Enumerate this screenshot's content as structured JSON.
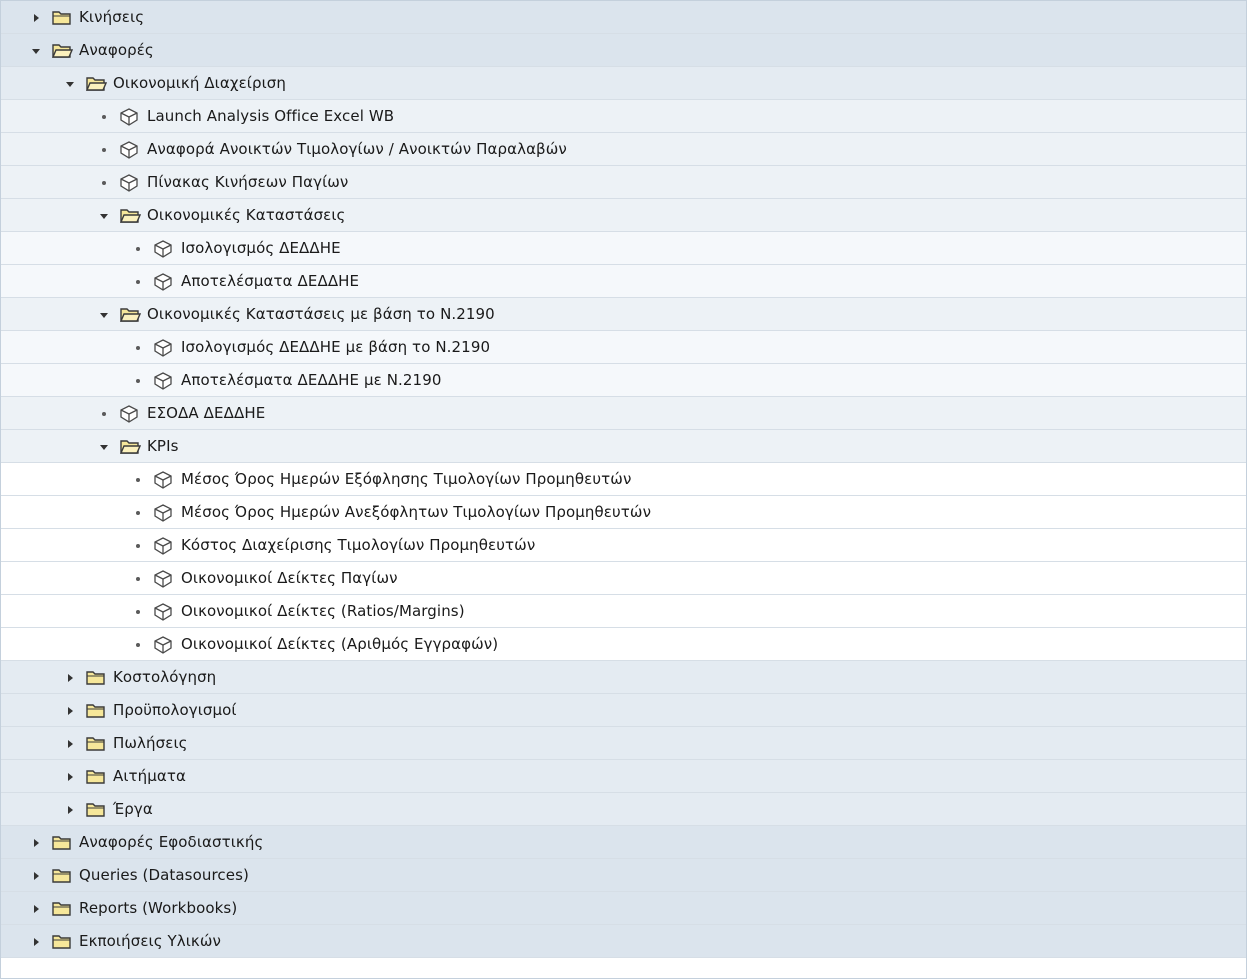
{
  "tree": [
    {
      "label": "Κινήσεις",
      "type": "folder",
      "state": "collapsed",
      "level": 0,
      "bg": "l0"
    },
    {
      "label": "Αναφορές",
      "type": "folder",
      "state": "expanded",
      "level": 0,
      "bg": "l0"
    },
    {
      "label": "Οικονομική Διαχείριση",
      "type": "folder",
      "state": "expanded",
      "level": 1,
      "bg": "l1"
    },
    {
      "label": "Launch Analysis Office Excel WB",
      "type": "report",
      "level": 2,
      "bg": "l2"
    },
    {
      "label": "Αναφορά Ανοικτών Τιμολογίων / Ανοικτών Παραλαβών",
      "type": "report",
      "level": 2,
      "bg": "l2"
    },
    {
      "label": "Πίνακας Κινήσεων Παγίων",
      "type": "report",
      "level": 2,
      "bg": "l2"
    },
    {
      "label": "Οικονομικές Καταστάσεις",
      "type": "folder",
      "state": "expanded",
      "level": 2,
      "bg": "l2"
    },
    {
      "label": "Ισολογισμός ΔΕΔΔΗΕ",
      "type": "report",
      "level": 3,
      "bg": "l3"
    },
    {
      "label": "Αποτελέσματα ΔΕΔΔΗΕ",
      "type": "report",
      "level": 3,
      "bg": "l3"
    },
    {
      "label": "Οικονομικές Καταστάσεις με βάση το Ν.2190",
      "type": "folder",
      "state": "expanded",
      "level": 2,
      "bg": "l2"
    },
    {
      "label": "Ισολογισμός ΔΕΔΔΗΕ με βάση το Ν.2190",
      "type": "report",
      "level": 3,
      "bg": "l3"
    },
    {
      "label": "Αποτελέσματα ΔΕΔΔΗΕ με Ν.2190",
      "type": "report",
      "level": 3,
      "bg": "l3"
    },
    {
      "label": "ΕΣΟΔΑ ΔΕΔΔΗΕ",
      "type": "report",
      "level": 2,
      "bg": "l2"
    },
    {
      "label": "KPIs",
      "type": "folder",
      "state": "expanded",
      "level": 2,
      "bg": "l2"
    },
    {
      "label": "Μέσος Όρος Ημερών Εξόφλησης Τιμολογίων Προμηθευτών",
      "type": "report",
      "level": 3,
      "bg": "white"
    },
    {
      "label": "Μέσος Όρος Ημερών Ανεξόφλητων Τιμολογίων Προμηθευτών",
      "type": "report",
      "level": 3,
      "bg": "white"
    },
    {
      "label": "Κόστος Διαχείρισης Τιμολογίων Προμηθευτών",
      "type": "report",
      "level": 3,
      "bg": "white"
    },
    {
      "label": "Οικονομικοί Δείκτες Παγίων",
      "type": "report",
      "level": 3,
      "bg": "white"
    },
    {
      "label": "Οικονομικοί Δείκτες (Ratios/Margins)",
      "type": "report",
      "level": 3,
      "bg": "white"
    },
    {
      "label": "Οικονομικοί Δείκτες (Αριθμός Εγγραφών)",
      "type": "report",
      "level": 3,
      "bg": "white"
    },
    {
      "label": "Κοστολόγηση",
      "type": "folder",
      "state": "collapsed",
      "level": 1,
      "bg": "l1"
    },
    {
      "label": "Προϋπολογισμοί",
      "type": "folder",
      "state": "collapsed",
      "level": 1,
      "bg": "l1"
    },
    {
      "label": "Πωλήσεις",
      "type": "folder",
      "state": "collapsed",
      "level": 1,
      "bg": "l1"
    },
    {
      "label": "Αιτήματα",
      "type": "folder",
      "state": "collapsed",
      "level": 1,
      "bg": "l1"
    },
    {
      "label": "Έργα",
      "type": "folder",
      "state": "collapsed",
      "level": 1,
      "bg": "l1"
    },
    {
      "label": "Αναφορές Εφοδιαστικής",
      "type": "folder",
      "state": "collapsed",
      "level": 0,
      "bg": "l0"
    },
    {
      "label": "Queries (Datasources)",
      "type": "folder",
      "state": "collapsed",
      "level": 0,
      "bg": "l0"
    },
    {
      "label": "Reports (Workbooks)",
      "type": "folder",
      "state": "collapsed",
      "level": 0,
      "bg": "l0"
    },
    {
      "label": "Εκποιήσεις Υλικών",
      "type": "folder",
      "state": "collapsed",
      "level": 0,
      "bg": "l0"
    }
  ],
  "colors": {
    "folder_fill": "#f6e79a",
    "folder_stroke": "#3b3b3b",
    "report_stroke": "#4a4a4a",
    "arrow": "#333333"
  }
}
